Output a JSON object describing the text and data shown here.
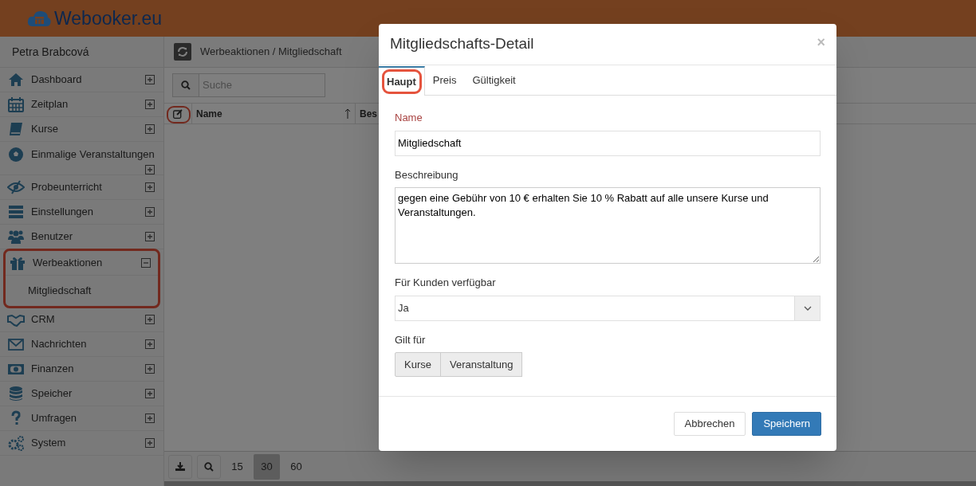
{
  "app": {
    "logo": "Webooker.eu"
  },
  "sidebar": {
    "user": "Petra Brabcová",
    "items": [
      {
        "label": "Dashboard",
        "expanded": false,
        "highlighted": false
      },
      {
        "label": "Zeitplan",
        "expanded": false,
        "highlighted": false
      },
      {
        "label": "Kurse",
        "expanded": false,
        "highlighted": false
      },
      {
        "label": "Einmalige Veranstaltungen",
        "expanded": false,
        "highlighted": false
      },
      {
        "label": "Probeunterricht",
        "expanded": false,
        "highlighted": false
      },
      {
        "label": "Einstellungen",
        "expanded": false,
        "highlighted": false
      },
      {
        "label": "Benutzer",
        "expanded": false,
        "highlighted": false
      },
      {
        "label": "Werbeaktionen",
        "expanded": true,
        "highlighted": true,
        "children": [
          {
            "label": "Mitgliedschaft"
          }
        ]
      },
      {
        "label": "CRM",
        "expanded": false,
        "highlighted": false
      },
      {
        "label": "Nachrichten",
        "expanded": false,
        "highlighted": false
      },
      {
        "label": "Finanzen",
        "expanded": false,
        "highlighted": false
      },
      {
        "label": "Speicher",
        "expanded": false,
        "highlighted": false
      },
      {
        "label": "Umfragen",
        "expanded": false,
        "highlighted": false
      },
      {
        "label": "System",
        "expanded": false,
        "highlighted": false
      }
    ]
  },
  "main": {
    "breadcrumb": "Werbeaktionen / Mitgliedschaft",
    "search": {
      "placeholder": "Suche"
    },
    "table": {
      "edit_column_highlighted": true,
      "columns": [
        {
          "label": "Name",
          "sorted": true
        },
        {
          "label": "Bes"
        }
      ]
    },
    "page_sizes": [
      {
        "label": "15",
        "selected": false
      },
      {
        "label": "30",
        "selected": true
      },
      {
        "label": "60",
        "selected": false
      }
    ]
  },
  "dialog": {
    "title": "Mitgliedschafts-Detail",
    "close": "×",
    "tabs": [
      {
        "label": "Haupt",
        "selected": true,
        "highlighted": true
      },
      {
        "label": "Preis",
        "selected": false,
        "highlighted": false
      },
      {
        "label": "Gültigkeit",
        "selected": false,
        "highlighted": false
      }
    ],
    "fields": [
      {
        "kind": "text",
        "label": "Name",
        "required": true,
        "value": "Mitgliedschaft"
      },
      {
        "kind": "textarea",
        "label": "Beschreibung",
        "required": false,
        "value": "gegen eine Gebühr von 10 € erhalten Sie 10 % Rabatt auf alle unsere Kurse und Veranstaltungen."
      },
      {
        "kind": "select",
        "label": "Für Kunden verfügbar",
        "required": false,
        "value": "Ja"
      },
      {
        "kind": "toggles",
        "label": "Gilt für",
        "required": false,
        "options": [
          {
            "label": "Kurse",
            "selected": false
          },
          {
            "label": "Veranstaltung",
            "selected": false
          }
        ]
      }
    ],
    "buttons": [
      {
        "label": "Abbrechen",
        "kind": "default"
      },
      {
        "label": "Speichern",
        "kind": "primary"
      }
    ]
  }
}
